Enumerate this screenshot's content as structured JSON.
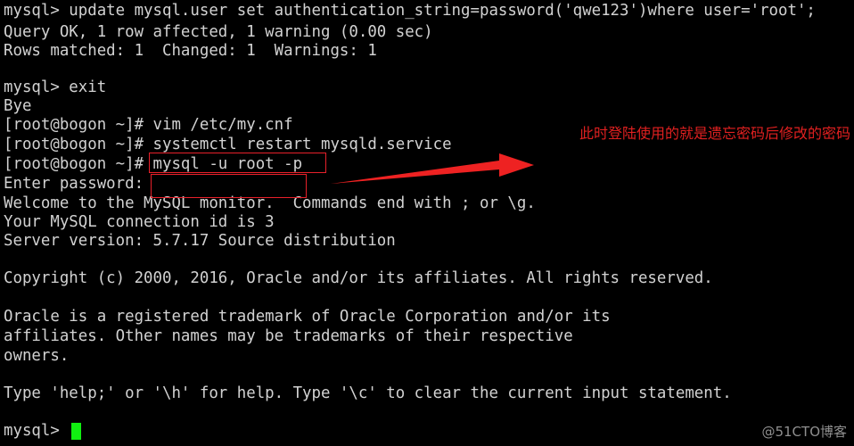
{
  "terminal": {
    "background_color": "#000000",
    "text_color": "#d2d2d2",
    "cursor_color": "#11ef11",
    "lines": [
      "mysql> update mysql.user set authentication_string=password('qwe123')where user='root';",
      "Query OK, 1 row affected, 1 warning (0.00 sec)",
      "Rows matched: 1  Changed: 1  Warnings: 1",
      "",
      "mysql> exit",
      "Bye",
      "[root@bogon ~]# vim /etc/my.cnf",
      "[root@bogon ~]# systemctl restart mysqld.service",
      "[root@bogon ~]# mysql -u root -p",
      "Enter password:",
      "Welcome to the MySQL monitor.  Commands end with ; or \\g.",
      "Your MySQL connection id is 3",
      "Server version: 5.7.17 Source distribution",
      "",
      "Copyright (c) 2000, 2016, Oracle and/or its affiliates. All rights reserved.",
      "",
      "Oracle is a registered trademark of Oracle Corporation and/or its",
      "affiliates. Other names may be trademarks of their respective",
      "owners.",
      "",
      "Type 'help;' or '\\h' for help. Type '\\c' to clear the current input statement.",
      "",
      "mysql>"
    ]
  },
  "annotations": {
    "color": "#e02020",
    "note_text": "此时登陆使用的就是遗忘密码后修改的密码",
    "highlight_command": "mysql -u root -p",
    "highlight_password_field": ""
  },
  "watermark": {
    "text": "@51CTO博客",
    "color": "#8f8f8f"
  }
}
